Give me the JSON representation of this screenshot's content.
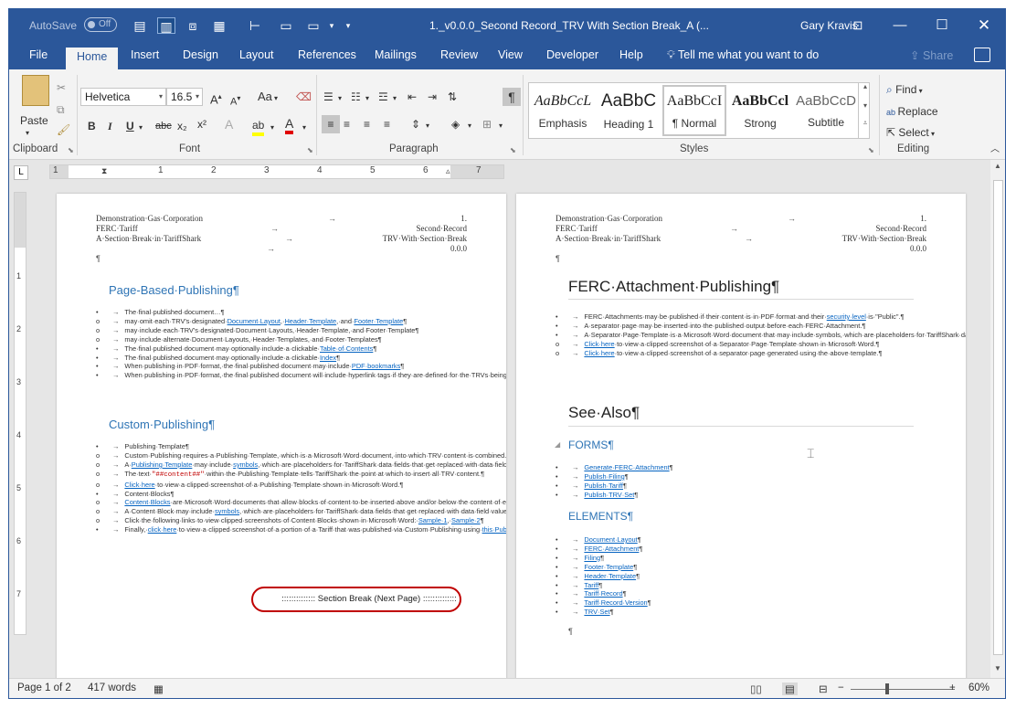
{
  "titlebar": {
    "autosave_label": "AutoSave",
    "autosave_state": "Off",
    "document_title": "1._v0.0.0_Second Record_TRV With Section Break_A (...",
    "user_name": "Gary Kravis",
    "quick_access": [
      "save-icon",
      "print-layout-icon",
      "page-fit-icon",
      "page-icon",
      "ruler-icon",
      "one-page-icon",
      "window-icon",
      "customize-icon"
    ],
    "window_buttons": [
      "ribbon-display-icon",
      "minimize-icon",
      "maximize-icon",
      "close-icon"
    ]
  },
  "tabs": [
    "File",
    "Home",
    "Insert",
    "Design",
    "Layout",
    "References",
    "Mailings",
    "Review",
    "View",
    "Developer",
    "Help"
  ],
  "active_tab": "Home",
  "tell_me": "Tell me what you want to do",
  "share": "Share",
  "ribbon": {
    "clipboard": {
      "paste": "Paste",
      "label": "Clipboard"
    },
    "font": {
      "name": "Helvetica",
      "size": "16.5",
      "label": "Font",
      "case_btn": "Aa",
      "bold": "B",
      "italic": "I",
      "underline": "U",
      "strike": "abc",
      "sub": "x₂",
      "sup": "x²",
      "effects": "A",
      "highlight": "ab",
      "color": "A"
    },
    "paragraph": {
      "label": "Paragraph"
    },
    "styles": {
      "label": "Styles",
      "items": [
        {
          "sample": "AaBbCcL",
          "name": "Emphasis"
        },
        {
          "sample": "AaBbC",
          "name": "Heading 1"
        },
        {
          "sample": "AaBbCcI",
          "name": "¶ Normal"
        },
        {
          "sample": "AaBbCcl",
          "name": "Strong"
        },
        {
          "sample": "AaBbCcD",
          "name": "Subtitle"
        }
      ]
    },
    "editing": {
      "find": "Find",
      "replace": "Replace",
      "select": "Select",
      "label": "Editing"
    }
  },
  "ruler": {
    "numbers": [
      "1",
      "1",
      "2",
      "3",
      "4",
      "5",
      "6",
      "7"
    ]
  },
  "page1": {
    "header_left": [
      "Demonstration·Gas·Corporation",
      "FERC·Tariff",
      "A·Section·Break·in·TariffShark"
    ],
    "header_right": [
      "1.",
      "Second·Record",
      "TRV·With·Section·Break",
      "0.0.0"
    ],
    "pilcrow": "¶",
    "h_page_based": "Page-Based·Publishing¶",
    "h_custom": "Custom·Publishing¶",
    "section_break": "Section Break (Next Page)",
    "list1": [
      {
        "b": "•",
        "t": [
          {
            "t": "The·final·published·document…¶"
          }
        ]
      },
      {
        "b": "o",
        "t": [
          {
            "t": "may·omit·each·TRV's·designated·"
          },
          {
            "l": "Document·Layout"
          },
          {
            "t": ",·"
          },
          {
            "l": "Header·Template"
          },
          {
            "t": ",·and·"
          },
          {
            "l": "Footer·Template"
          },
          {
            "t": "¶"
          }
        ]
      },
      {
        "b": "o",
        "t": [
          {
            "t": "may·include·each·TRV's·designated·Document·Layouts,·Header·Template,·and·Footer·Template¶"
          }
        ]
      },
      {
        "b": "o",
        "t": [
          {
            "t": "may·include·alternate·Document·Layouts,·Header·Templates,·and·Footer·Templates¶"
          }
        ]
      },
      {
        "b": "•",
        "t": [
          {
            "t": "The·final·published·document·may·optionally·include·a·clickable·"
          },
          {
            "l": "Table·of·Contents"
          },
          {
            "t": "¶"
          }
        ]
      },
      {
        "b": "•",
        "t": [
          {
            "t": "The·final·published·document·may·optionally·include·a·clickable·"
          },
          {
            "l": "Index"
          },
          {
            "t": "¶"
          }
        ]
      },
      {
        "b": "•",
        "t": [
          {
            "t": "When·publishing·in·PDF·format,·the·final·published·document·may·include·"
          },
          {
            "l": "PDF·bookmarks"
          },
          {
            "t": "¶"
          }
        ]
      },
      {
        "b": "•",
        "t": [
          {
            "t": "When·publishing·in·PDF·format,·the·final·published·document·will·include·hyperlink·tags·if·they·are·defined·for·the·TRVs·being·published¶"
          }
        ]
      }
    ],
    "list2": [
      {
        "b": "•",
        "t": [
          {
            "t": "Publishing·Template¶"
          }
        ]
      },
      {
        "b": "o",
        "t": [
          {
            "t": "Custom·Publishing·requires·a·Publishing·Template,·which·is·a·Microsoft·Word·document,·into·which·TRV·content·is·combined.¶"
          }
        ]
      },
      {
        "b": "o",
        "t": [
          {
            "t": "A·"
          },
          {
            "l": "Publishing·Template"
          },
          {
            "t": "·may·include·"
          },
          {
            "l": "symbols"
          },
          {
            "t": ",·which·are·placeholders·for·TariffShark·data·fields·that·get·replaced·with·data·field·values·during·publishing.¶"
          }
        ]
      },
      {
        "b": "o",
        "t": [
          {
            "t": "The·text·"
          },
          {
            "c": "\"##content##\""
          },
          {
            "t": "·within·the·Publishing·Template·tells·TariffShark·the·point·at·which·to·insert·all·TRV·content.¶"
          }
        ]
      },
      {
        "b": "o",
        "t": [
          {
            "l": "Click·here"
          },
          {
            "t": "·to·view·a·clipped·screenshot·of·a·Publishing·Template·shown·in·Microsoft·Word.¶"
          }
        ]
      },
      {
        "b": "•",
        "t": [
          {
            "t": "Content·Blocks¶"
          }
        ]
      },
      {
        "b": "o",
        "t": [
          {
            "l": "Content·Blocks"
          },
          {
            "t": "·are·Microsoft·Word·documents·that·allow·blocks·of·content·to·be·inserted·above·and/or·below·the·content·of·every·published·TRV.¶"
          }
        ]
      },
      {
        "b": "o",
        "t": [
          {
            "t": "A·Content·Block·may·include·"
          },
          {
            "l": "symbols"
          },
          {
            "t": ",·which·are·placeholders·for·TariffShark·data·fields·that·get·replaced·with·data·field·values·during·publishing.¶"
          }
        ]
      },
      {
        "b": "o",
        "t": [
          {
            "t": "Click·the·following·links·to·view·clipped·screenshots·of·Content·Blocks·shown·in·Microsoft·Word:·"
          },
          {
            "l": "Sample·1"
          },
          {
            "t": ",·"
          },
          {
            "l": "Sample·2"
          },
          {
            "t": "¶"
          }
        ]
      },
      {
        "b": "•",
        "t": [
          {
            "t": "Finally,·"
          },
          {
            "l": "click·here"
          },
          {
            "t": "·to·view·a·clipped·screenshot·of·a·portion·of·a·Tariff·that·was·published·via·Custom·Publishing·using·"
          },
          {
            "l": "this·Publishing·Template"
          },
          {
            "t": ",·"
          },
          {
            "l": "this·Content·Block"
          },
          {
            "t": "·before·each·TRV's·content,·and·"
          },
          {
            "l": "this·Content·Block"
          },
          {
            "t": "·after·each·TRV's·content.¶"
          }
        ]
      }
    ]
  },
  "page2": {
    "header_left": [
      "Demonstration·Gas·Corporation",
      "FERC·Tariff",
      "A·Section·Break·in·TariffShark"
    ],
    "header_right": [
      "1.",
      "Second·Record",
      "TRV·With·Section·Break",
      "0.0.0"
    ],
    "pilcrow": "¶",
    "h_ferc": "FERC·Attachment·Publishing¶",
    "h_see_also": "See·Also¶",
    "h_forms": "FORMS¶",
    "h_elements": "ELEMENTS¶",
    "list_ferc": [
      {
        "b": "•",
        "t": [
          {
            "t": "FERC·Attachments·may·be·published·if·their·content·is·in·PDF·format·and·their·"
          },
          {
            "l": "security·level"
          },
          {
            "t": "·is·\"Public\".¶"
          }
        ]
      },
      {
        "b": "•",
        "t": [
          {
            "t": "A·separator·page·may·be·inserted·into·the·published·output·before·each·FERC·Attachment.¶"
          }
        ]
      },
      {
        "b": "•",
        "t": [
          {
            "t": "A·Separator·Page·Template·is·a·Microsoft·Word·document·that·may·include·symbols,·which·are·placeholders·for·TariffShark·data·fields·that·get·replaced·with·data·field·values·during·publishing.¶"
          }
        ]
      },
      {
        "b": "o",
        "t": [
          {
            "l": "Click·here"
          },
          {
            "t": "·to·view·a·clipped·screenshot·of·a·Separator·Page·Template·shown·in·Microsoft·Word.¶"
          }
        ]
      },
      {
        "b": "o",
        "t": [
          {
            "l": "Click·here"
          },
          {
            "t": "·to·view·a·clipped·screenshot·of·a·separator·page·generated·using·the·above·template.¶"
          }
        ]
      }
    ],
    "forms": [
      "Generate·FERC·Attachment",
      "Publish·Filing",
      "Publish·Tariff",
      "Publish·TRV·Set"
    ],
    "elements": [
      "Document·Layout",
      "FERC·Attachment",
      "Filing",
      "Footer·Template",
      "Header·Template",
      "Tariff",
      "Tariff·Record",
      "Tariff·Record·Version",
      "TRV·Set"
    ]
  },
  "status": {
    "page": "Page 1 of 2",
    "words": "417 words",
    "zoom": "60%",
    "zoom_fraction": 0.35
  }
}
